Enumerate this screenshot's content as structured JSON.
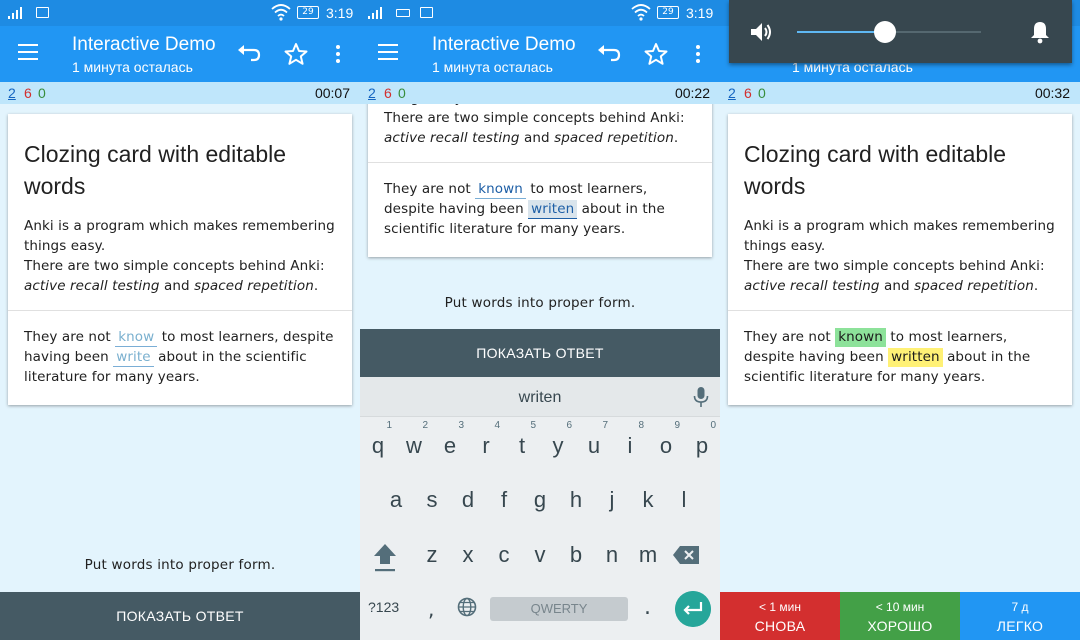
{
  "app": {
    "title": "Interactive Demo",
    "subtitle": "1 минута осталась",
    "time": "3:19",
    "battery": "29"
  },
  "card": {
    "heading": "Clozing card with editable words",
    "line1": "Anki is a program which makes remembering things easy.",
    "line2": "There are two simple concepts behind Anki:",
    "concept1": "active recall testing",
    "conj": "and",
    "concept2": "spaced repetition",
    "period": ".",
    "cloze_pre": "They are not",
    "cloze_mid": "to most learners, despite having been",
    "cloze_post": "about in the scientific literature for many years.",
    "hint": "Put words into proper form.",
    "show_answer": "ПОКАЗАТЬ ОТВЕТ"
  },
  "screens": [
    {
      "counts": {
        "new": "2",
        "learn": "6",
        "review": "0"
      },
      "timer": "00:07",
      "blank1": "know",
      "blank2": "write"
    },
    {
      "counts": {
        "new": "2",
        "learn": "6",
        "review": "0"
      },
      "timer": "00:22",
      "blank1": "known",
      "blank2": "writen"
    },
    {
      "counts": {
        "new": "2",
        "learn": "6",
        "review": "0"
      },
      "timer": "00:32",
      "blank1": "known",
      "blank2": "written"
    }
  ],
  "keyboard": {
    "suggestion": "writen",
    "row1": [
      "q",
      "w",
      "e",
      "r",
      "t",
      "y",
      "u",
      "i",
      "o",
      "p"
    ],
    "row1_nums": [
      "1",
      "2",
      "3",
      "4",
      "5",
      "6",
      "7",
      "8",
      "9",
      "0"
    ],
    "row2": [
      "a",
      "s",
      "d",
      "f",
      "g",
      "h",
      "j",
      "k",
      "l"
    ],
    "row3": [
      "z",
      "x",
      "c",
      "v",
      "b",
      "n",
      "m"
    ],
    "symbols": "?123",
    "comma": ",",
    "space": "QWERTY",
    "dot": "."
  },
  "volume": {
    "level": 0.48,
    "accent": "#5fb8f3"
  },
  "ease_buttons": [
    {
      "time": "< 1 мин",
      "label": "СНОВА",
      "color": "#d32f2f"
    },
    {
      "time": "< 10 мин",
      "label": "ХОРОШО",
      "color": "#43a047"
    },
    {
      "time": "7 д",
      "label": "ЛЕГКО",
      "color": "#2196f3"
    }
  ],
  "colors": {
    "toolbar": "#2196f3",
    "statusbar": "#1e8be3",
    "answer_bar": "#455a64",
    "background": "#e3f4fd"
  }
}
